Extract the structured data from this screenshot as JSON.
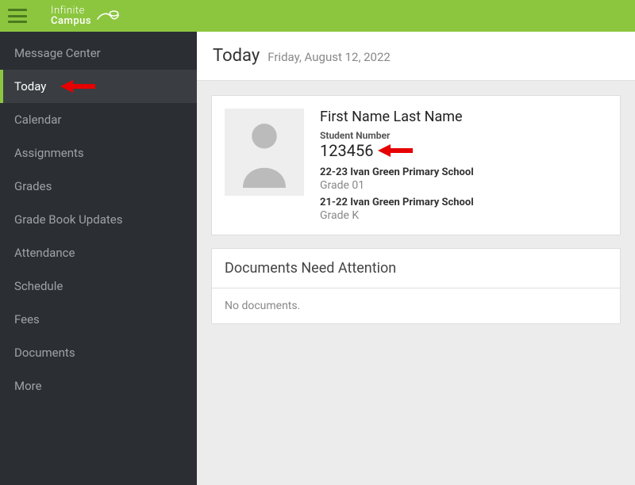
{
  "header": {
    "logo_top": "Infinite",
    "logo_bottom": "Campus"
  },
  "sidebar": {
    "items": [
      {
        "label": "Message Center",
        "active": false
      },
      {
        "label": "Today",
        "active": true
      },
      {
        "label": "Calendar",
        "active": false
      },
      {
        "label": "Assignments",
        "active": false
      },
      {
        "label": "Grades",
        "active": false
      },
      {
        "label": "Grade Book Updates",
        "active": false
      },
      {
        "label": "Attendance",
        "active": false
      },
      {
        "label": "Schedule",
        "active": false
      },
      {
        "label": "Fees",
        "active": false
      },
      {
        "label": "Documents",
        "active": false
      },
      {
        "label": "More",
        "active": false
      }
    ]
  },
  "page": {
    "title": "Today",
    "date": "Friday, August 12, 2022"
  },
  "student": {
    "name": "First Name  Last Name",
    "number_label": "Student Number",
    "number": "123456",
    "enrollments": [
      {
        "year": "22-23",
        "school": "Ivan Green Primary School",
        "grade": "Grade 01"
      },
      {
        "year": "21-22",
        "school": "Ivan Green Primary School",
        "grade": "Grade K"
      }
    ]
  },
  "documents": {
    "header": "Documents Need Attention",
    "empty": "No documents."
  },
  "annotations": {
    "arrow_color": "#e60000"
  }
}
